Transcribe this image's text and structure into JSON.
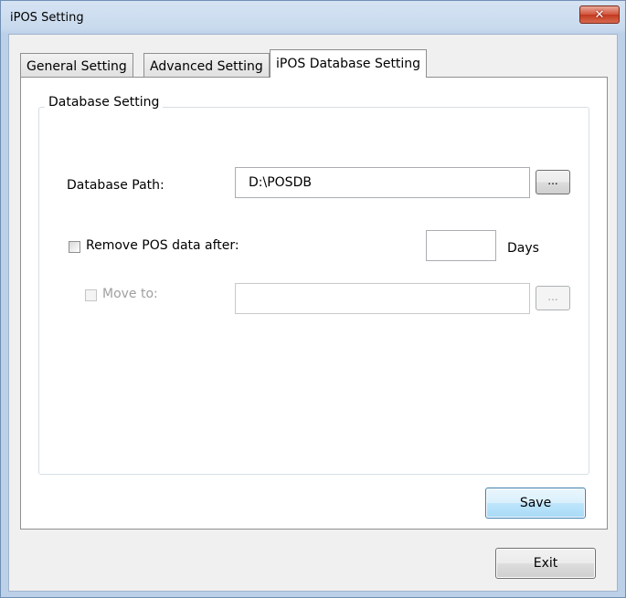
{
  "window": {
    "title": "iPOS Setting",
    "close_glyph": "✕"
  },
  "tabs": [
    {
      "label": "General Setting",
      "active": false
    },
    {
      "label": "Advanced Setting",
      "active": false
    },
    {
      "label": "iPOS Database Setting",
      "active": true
    }
  ],
  "database_group": {
    "legend": "Database Setting",
    "path_label": "Database Path:",
    "path_value": "D:\\POSDB",
    "browse_label": "...",
    "remove_label": "Remove POS data after:",
    "remove_checked": false,
    "days_value": "",
    "days_label": "Days",
    "move_label": "Move to:",
    "move_checked": false,
    "move_value": "",
    "move_browse_label": "..."
  },
  "buttons": {
    "save_label": "Save",
    "exit_label": "Exit"
  },
  "icons": {
    "close": "close-icon"
  },
  "colors": {
    "close_button": "#c2381f",
    "default_button_border": "#3c7fb1"
  }
}
